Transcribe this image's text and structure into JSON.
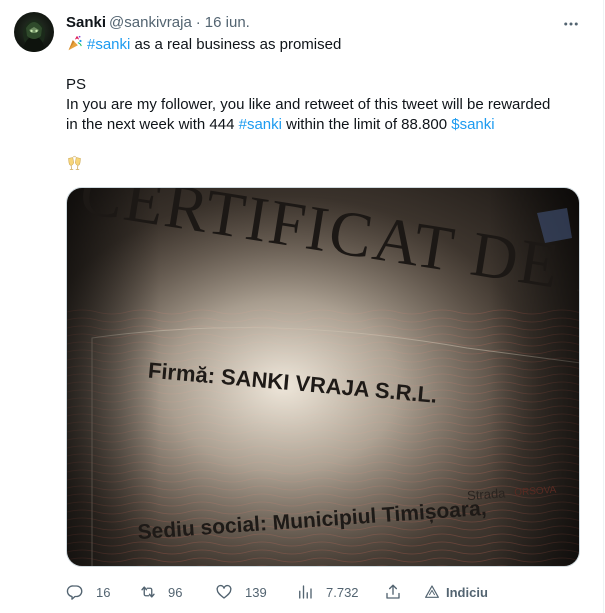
{
  "author": {
    "display_name": "Sanki",
    "handle": "@sankivraja",
    "separator": "·",
    "date": "16 iun."
  },
  "tweet": {
    "line1_emoji": "party-popper-icon",
    "line1_hashtag": "#sanki",
    "line1_rest": " as a real business as promised",
    "ps": "PS",
    "line3": "In you are my follower, you like and retweet of this tweet will be rewarded",
    "line4_a": "in the next week with 444 ",
    "line4_hashtag": "#sanki",
    "line4_b": " within the limit of 88.800 ",
    "line4_cashtag": "$sanki",
    "last_emoji": "clinking-glasses-icon"
  },
  "media": {
    "cert_title": "CERTIFICAT DE ÎNR",
    "firma_label": "Firmă: SANKI VRAJA S.R.L.",
    "sediu_label": "Sediu social: Municipiul Timișoara,",
    "strada_label": "Strada",
    "strada_tail": "ORSOVA"
  },
  "actions": {
    "replies": "16",
    "retweets": "96",
    "likes": "139",
    "views": "7.732",
    "share_icon": "share-icon",
    "indiciu": "Indiciu"
  },
  "colors": {
    "link": "#1d9bf0",
    "secondary": "#536471",
    "primary_text": "#0f1419"
  }
}
